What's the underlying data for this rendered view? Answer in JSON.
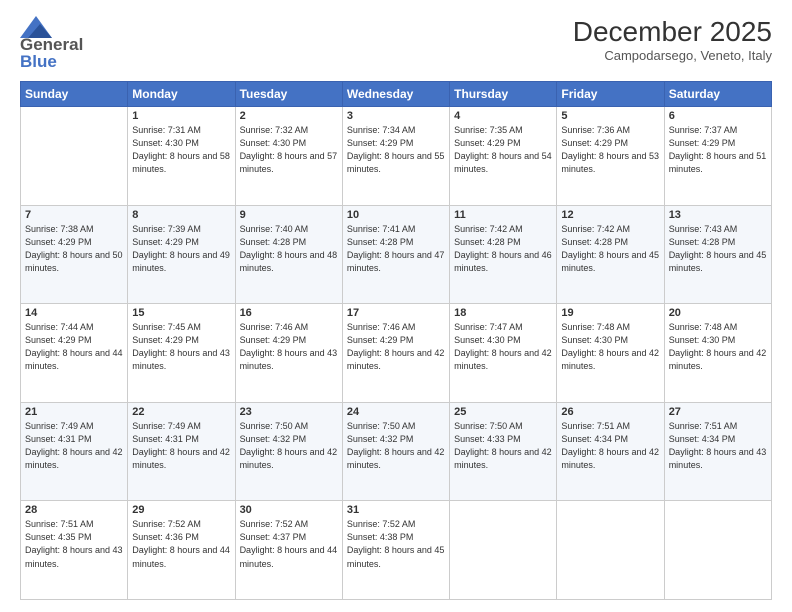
{
  "logo": {
    "line1": "General",
    "line2": "Blue"
  },
  "title": "December 2025",
  "location": "Campodarsego, Veneto, Italy",
  "weekdays": [
    "Sunday",
    "Monday",
    "Tuesday",
    "Wednesday",
    "Thursday",
    "Friday",
    "Saturday"
  ],
  "weeks": [
    [
      {
        "day": "",
        "sunrise": "",
        "sunset": "",
        "daylight": ""
      },
      {
        "day": "1",
        "sunrise": "Sunrise: 7:31 AM",
        "sunset": "Sunset: 4:30 PM",
        "daylight": "Daylight: 8 hours and 58 minutes."
      },
      {
        "day": "2",
        "sunrise": "Sunrise: 7:32 AM",
        "sunset": "Sunset: 4:30 PM",
        "daylight": "Daylight: 8 hours and 57 minutes."
      },
      {
        "day": "3",
        "sunrise": "Sunrise: 7:34 AM",
        "sunset": "Sunset: 4:29 PM",
        "daylight": "Daylight: 8 hours and 55 minutes."
      },
      {
        "day": "4",
        "sunrise": "Sunrise: 7:35 AM",
        "sunset": "Sunset: 4:29 PM",
        "daylight": "Daylight: 8 hours and 54 minutes."
      },
      {
        "day": "5",
        "sunrise": "Sunrise: 7:36 AM",
        "sunset": "Sunset: 4:29 PM",
        "daylight": "Daylight: 8 hours and 53 minutes."
      },
      {
        "day": "6",
        "sunrise": "Sunrise: 7:37 AM",
        "sunset": "Sunset: 4:29 PM",
        "daylight": "Daylight: 8 hours and 51 minutes."
      }
    ],
    [
      {
        "day": "7",
        "sunrise": "Sunrise: 7:38 AM",
        "sunset": "Sunset: 4:29 PM",
        "daylight": "Daylight: 8 hours and 50 minutes."
      },
      {
        "day": "8",
        "sunrise": "Sunrise: 7:39 AM",
        "sunset": "Sunset: 4:29 PM",
        "daylight": "Daylight: 8 hours and 49 minutes."
      },
      {
        "day": "9",
        "sunrise": "Sunrise: 7:40 AM",
        "sunset": "Sunset: 4:28 PM",
        "daylight": "Daylight: 8 hours and 48 minutes."
      },
      {
        "day": "10",
        "sunrise": "Sunrise: 7:41 AM",
        "sunset": "Sunset: 4:28 PM",
        "daylight": "Daylight: 8 hours and 47 minutes."
      },
      {
        "day": "11",
        "sunrise": "Sunrise: 7:42 AM",
        "sunset": "Sunset: 4:28 PM",
        "daylight": "Daylight: 8 hours and 46 minutes."
      },
      {
        "day": "12",
        "sunrise": "Sunrise: 7:42 AM",
        "sunset": "Sunset: 4:28 PM",
        "daylight": "Daylight: 8 hours and 45 minutes."
      },
      {
        "day": "13",
        "sunrise": "Sunrise: 7:43 AM",
        "sunset": "Sunset: 4:28 PM",
        "daylight": "Daylight: 8 hours and 45 minutes."
      }
    ],
    [
      {
        "day": "14",
        "sunrise": "Sunrise: 7:44 AM",
        "sunset": "Sunset: 4:29 PM",
        "daylight": "Daylight: 8 hours and 44 minutes."
      },
      {
        "day": "15",
        "sunrise": "Sunrise: 7:45 AM",
        "sunset": "Sunset: 4:29 PM",
        "daylight": "Daylight: 8 hours and 43 minutes."
      },
      {
        "day": "16",
        "sunrise": "Sunrise: 7:46 AM",
        "sunset": "Sunset: 4:29 PM",
        "daylight": "Daylight: 8 hours and 43 minutes."
      },
      {
        "day": "17",
        "sunrise": "Sunrise: 7:46 AM",
        "sunset": "Sunset: 4:29 PM",
        "daylight": "Daylight: 8 hours and 42 minutes."
      },
      {
        "day": "18",
        "sunrise": "Sunrise: 7:47 AM",
        "sunset": "Sunset: 4:30 PM",
        "daylight": "Daylight: 8 hours and 42 minutes."
      },
      {
        "day": "19",
        "sunrise": "Sunrise: 7:48 AM",
        "sunset": "Sunset: 4:30 PM",
        "daylight": "Daylight: 8 hours and 42 minutes."
      },
      {
        "day": "20",
        "sunrise": "Sunrise: 7:48 AM",
        "sunset": "Sunset: 4:30 PM",
        "daylight": "Daylight: 8 hours and 42 minutes."
      }
    ],
    [
      {
        "day": "21",
        "sunrise": "Sunrise: 7:49 AM",
        "sunset": "Sunset: 4:31 PM",
        "daylight": "Daylight: 8 hours and 42 minutes."
      },
      {
        "day": "22",
        "sunrise": "Sunrise: 7:49 AM",
        "sunset": "Sunset: 4:31 PM",
        "daylight": "Daylight: 8 hours and 42 minutes."
      },
      {
        "day": "23",
        "sunrise": "Sunrise: 7:50 AM",
        "sunset": "Sunset: 4:32 PM",
        "daylight": "Daylight: 8 hours and 42 minutes."
      },
      {
        "day": "24",
        "sunrise": "Sunrise: 7:50 AM",
        "sunset": "Sunset: 4:32 PM",
        "daylight": "Daylight: 8 hours and 42 minutes."
      },
      {
        "day": "25",
        "sunrise": "Sunrise: 7:50 AM",
        "sunset": "Sunset: 4:33 PM",
        "daylight": "Daylight: 8 hours and 42 minutes."
      },
      {
        "day": "26",
        "sunrise": "Sunrise: 7:51 AM",
        "sunset": "Sunset: 4:34 PM",
        "daylight": "Daylight: 8 hours and 42 minutes."
      },
      {
        "day": "27",
        "sunrise": "Sunrise: 7:51 AM",
        "sunset": "Sunset: 4:34 PM",
        "daylight": "Daylight: 8 hours and 43 minutes."
      }
    ],
    [
      {
        "day": "28",
        "sunrise": "Sunrise: 7:51 AM",
        "sunset": "Sunset: 4:35 PM",
        "daylight": "Daylight: 8 hours and 43 minutes."
      },
      {
        "day": "29",
        "sunrise": "Sunrise: 7:52 AM",
        "sunset": "Sunset: 4:36 PM",
        "daylight": "Daylight: 8 hours and 44 minutes."
      },
      {
        "day": "30",
        "sunrise": "Sunrise: 7:52 AM",
        "sunset": "Sunset: 4:37 PM",
        "daylight": "Daylight: 8 hours and 44 minutes."
      },
      {
        "day": "31",
        "sunrise": "Sunrise: 7:52 AM",
        "sunset": "Sunset: 4:38 PM",
        "daylight": "Daylight: 8 hours and 45 minutes."
      },
      {
        "day": "",
        "sunrise": "",
        "sunset": "",
        "daylight": ""
      },
      {
        "day": "",
        "sunrise": "",
        "sunset": "",
        "daylight": ""
      },
      {
        "day": "",
        "sunrise": "",
        "sunset": "",
        "daylight": ""
      }
    ]
  ]
}
